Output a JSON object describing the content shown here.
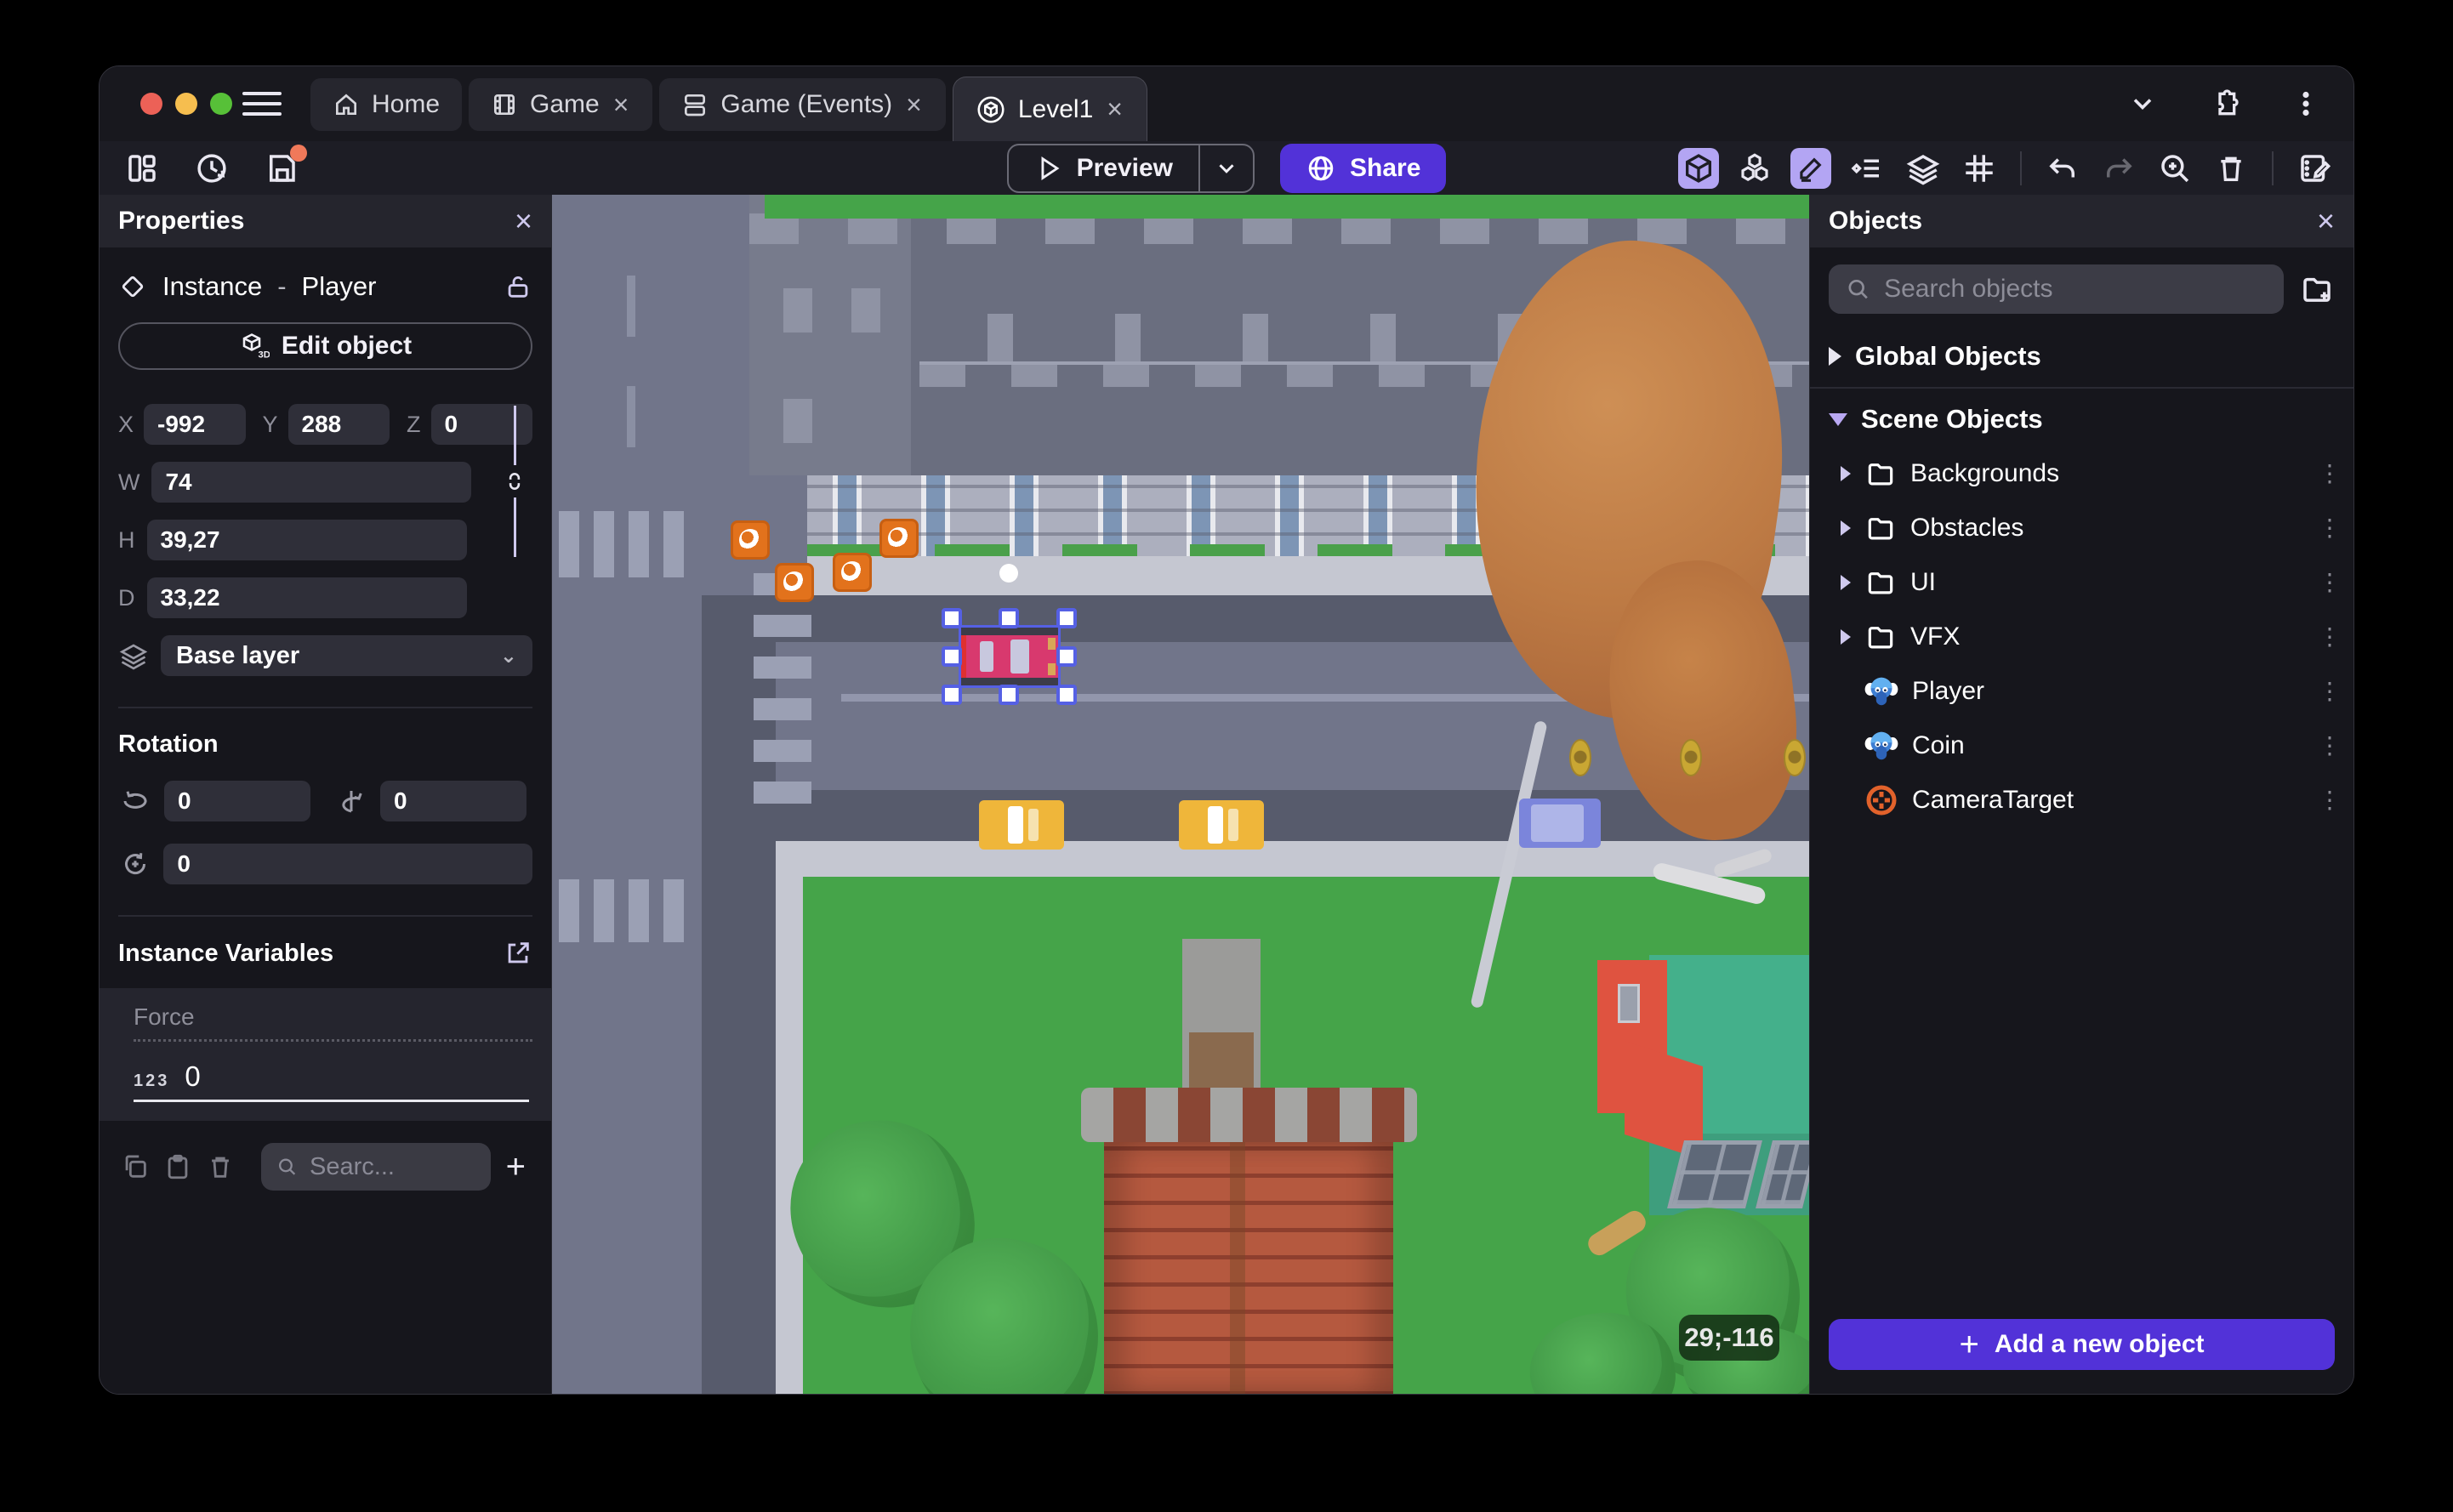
{
  "window": {
    "close_symbol": "×",
    "tabs": [
      {
        "label": "Home"
      },
      {
        "label": "Game"
      },
      {
        "label": "Game (Events)"
      },
      {
        "label": "Level1"
      }
    ]
  },
  "toolbar": {
    "preview_label": "Preview",
    "share_label": "Share"
  },
  "properties_panel": {
    "title": "Properties",
    "instance_kind": "Instance",
    "separator": "-",
    "instance_object": "Player",
    "edit_object_label": "Edit object",
    "x_label": "X",
    "x_value": "-992",
    "y_label": "Y",
    "y_value": "288",
    "z_label": "Z",
    "z_value": "0",
    "w_label": "W",
    "w_value": "74",
    "h_label": "H",
    "h_value": "39,27",
    "d_label": "D",
    "d_value": "33,22",
    "layer_value": "Base layer",
    "rotation_title": "Rotation",
    "rotation_x": "0",
    "rotation_y": "0",
    "rotation_z": "0",
    "variables_title": "Instance Variables",
    "variable_name": "Force",
    "variable_type_badge": "123",
    "variable_value": "0",
    "variables_search_placeholder": "Searc..."
  },
  "objects_panel": {
    "title": "Objects",
    "search_placeholder": "Search objects",
    "global_group_label": "Global Objects",
    "scene_group_label": "Scene Objects",
    "items": [
      {
        "label": "Backgrounds",
        "icon": "folder"
      },
      {
        "label": "Obstacles",
        "icon": "folder"
      },
      {
        "label": "UI",
        "icon": "folder"
      },
      {
        "label": "VFX",
        "icon": "folder"
      },
      {
        "label": "Player",
        "icon": "monkey"
      },
      {
        "label": "Coin",
        "icon": "monkey"
      },
      {
        "label": "CameraTarget",
        "icon": "target"
      }
    ],
    "add_button_label": "Add a new object"
  },
  "canvas": {
    "coordinates_badge": "29;-116"
  },
  "colors": {
    "accent_purple": "#5232D8",
    "toolbar_toggle_active": "#B3A5F3",
    "traffic_red": "#EC6157",
    "traffic_yellow": "#F6BE4F",
    "traffic_green": "#57C038",
    "save_badge_dot": "#F0795A",
    "selection_blue": "#5560E4",
    "grass": "#45A449",
    "road_light": "#71758A",
    "road_dark": "#575B6C",
    "sidewalk": "#C5C7D1",
    "brick": "#B5593F",
    "house_roof_teal": "#44B08B",
    "house_wall_red": "#DF5340",
    "pickup_orange": "#E2721C",
    "coin_gold": "#C9A733"
  }
}
